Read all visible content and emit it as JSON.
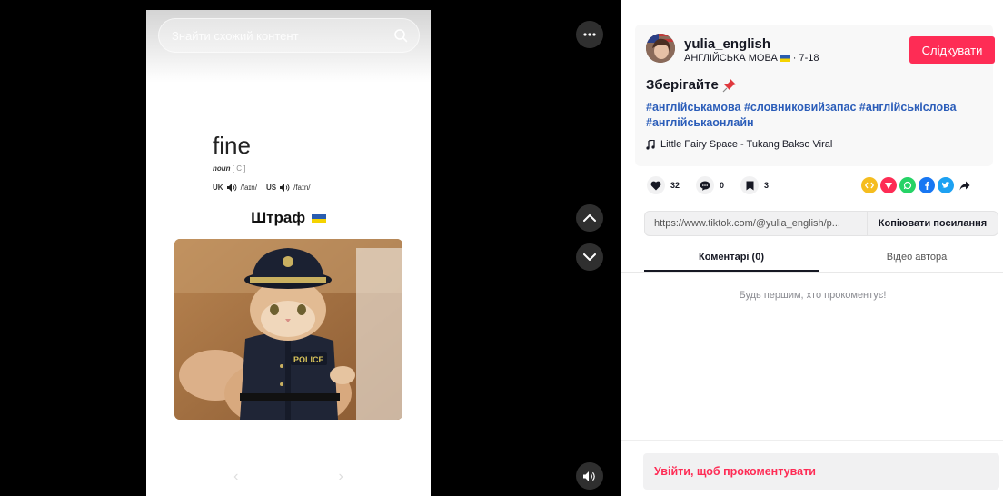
{
  "video": {
    "search_placeholder": "Знайти схожий контент",
    "word": "fine",
    "part_of_speech": "noun",
    "grammar_code": "[ C ]",
    "uk_label": "UK",
    "uk_ipa": "/faɪn/",
    "us_label": "US",
    "us_ipa": "/faɪn/",
    "translation": "Штраф",
    "photo_text": "POLICE",
    "prev_label": "‹",
    "next_label": "›"
  },
  "author": {
    "username": "yulia_english",
    "display_line": "АНГЛІЙСЬКА МОВА",
    "date": "· 7-18",
    "follow_label": "Слідкувати"
  },
  "post": {
    "title": "Зберігайте",
    "hashtags": [
      "#англійськамова",
      "#словниковийзапас",
      "#англійськіслова",
      "#англійськаонлайн"
    ],
    "music": "Little Fairy Space - Tukang Bakso Viral"
  },
  "stats": {
    "likes": "32",
    "comments": "0",
    "saves": "3"
  },
  "share": {
    "link": "https://www.tiktok.com/@yulia_english/p...",
    "copy_label": "Копіювати посилання"
  },
  "tabs": {
    "comments": "Коментарі (0)",
    "author_videos": "Відео автора"
  },
  "comments": {
    "empty_message": "Будь першим, хто прокоментує!",
    "login_prompt": "Увійти, щоб прокоментувати"
  },
  "colors": {
    "accent": "#fe2c55",
    "hashtag": "#2b5db9",
    "video_bg": "#000000"
  }
}
